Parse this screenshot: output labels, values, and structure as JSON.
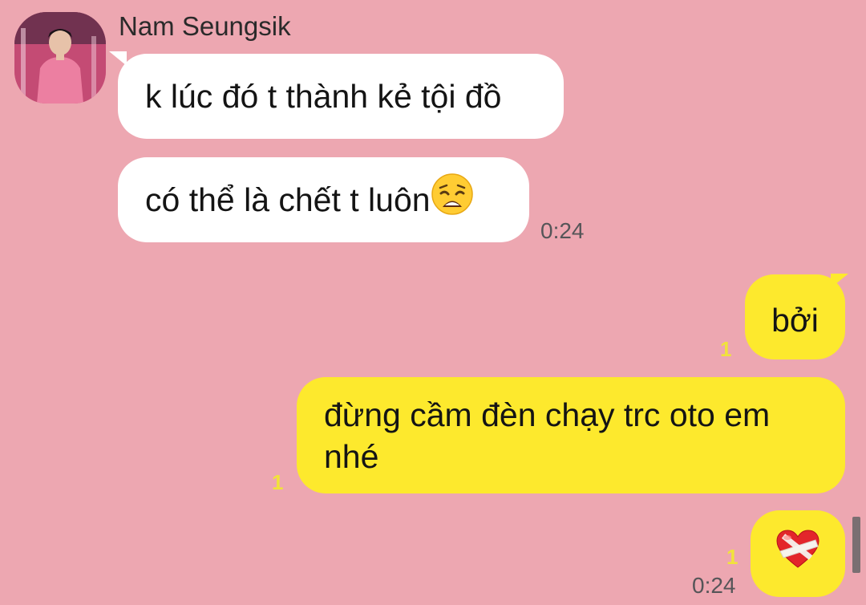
{
  "contact": {
    "name": "Nam Seungsik"
  },
  "messages": {
    "m1": "k lúc đó t thành kẻ tội đồ",
    "m2": "có thể là chết t luôn",
    "m2_emoji": "weary-face",
    "m2_time": "0:24",
    "m3": "bởi",
    "m3_unread": "1",
    "m4": "đừng cầm đèn chạy trc oto em nhé",
    "m4_unread": "1",
    "m5_emoji": "bandaged-heart",
    "m5_unread": "1",
    "m5_time": "0:24"
  },
  "colors": {
    "background": "#eda7b1",
    "incoming_bubble": "#ffffff",
    "outgoing_bubble": "#fde92d",
    "unread_count": "#f1e23b"
  }
}
